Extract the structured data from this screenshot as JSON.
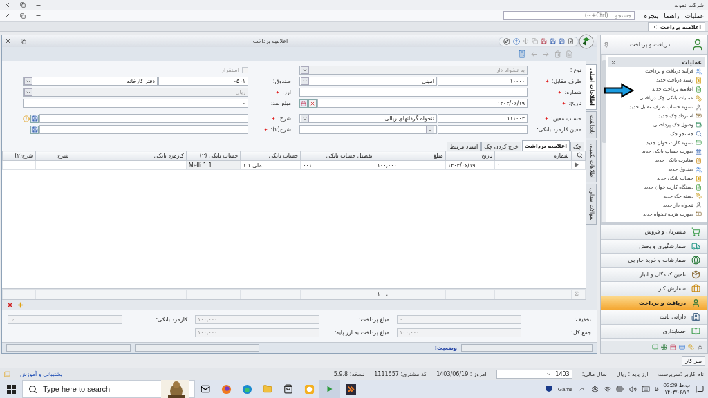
{
  "app_title": "شرکت نمونه",
  "menu": [
    {
      "label": "عملیات"
    },
    {
      "label": "راهنما"
    },
    {
      "label": "پنجره"
    }
  ],
  "search": {
    "placeholder": "جستجو... (Ctrl+~)"
  },
  "doc_tabs": [
    {
      "label": "اعلامیه پرداخت",
      "selected": true
    }
  ],
  "form_window": {
    "title": "اعلامیه پرداخت",
    "side_tabs": [
      {
        "label": "اطلاعات اصلی",
        "selected": true
      },
      {
        "label": "یادداشت",
        "selected": false
      },
      {
        "label": "اطلاعات تکمیلی",
        "selected": false
      },
      {
        "label": "سوالات متداول",
        "selected": false
      }
    ],
    "right_column": {
      "top": [
        {
          "label": "نوع :",
          "required": true,
          "kind": "combo",
          "value": "به تنخواه دار",
          "disabled": true
        },
        {
          "label": "طرف مقابل:",
          "required": true,
          "kind": "code_combo",
          "code": "۱۰۰۰۰",
          "value": "امینی"
        },
        {
          "label": "شماره:",
          "required": true,
          "kind": "text"
        },
        {
          "label": "تاریخ:",
          "required": true,
          "kind": "date",
          "value": "۱۴۰۳/۰۶/۱۹"
        }
      ],
      "bottom": [
        {
          "label": "حساب معین:",
          "required": true,
          "kind": "code_combo",
          "code": "۱۱۱۰۰۳",
          "value": "تنخواه گردانهای ریالی"
        },
        {
          "label": "معین کارمزد بانکی:",
          "required": false,
          "kind": "code_combo"
        }
      ]
    },
    "left_column": {
      "checkbox": {
        "label": "استقرار",
        "checked": false,
        "disabled": true
      },
      "top": [
        {
          "label": "صندوق:",
          "required": false,
          "kind": "code_combo",
          "code": "۰۵۰۱",
          "value": "دفتر کارخانه"
        },
        {
          "label": "ارز:",
          "required": true,
          "kind": "combo",
          "value": "ریال",
          "disabled": true
        },
        {
          "label": "مبلغ نقد:",
          "required": false,
          "kind": "text",
          "value": "۰"
        }
      ],
      "bottom": [
        {
          "label": "شرح:",
          "required": true,
          "kind": "memo",
          "warning": true
        },
        {
          "label": "شرح(۲):",
          "required": true,
          "kind": "memo",
          "warning": false
        }
      ]
    },
    "grid_tabs": [
      {
        "label": "چک",
        "selected": false
      },
      {
        "label": "اعلامیه برداشت",
        "selected": true
      },
      {
        "label": "خرج کردن چک",
        "selected": false
      },
      {
        "label": "اسناد مرتبط",
        "selected": false
      }
    ],
    "columns": [
      "شماره",
      "تاریخ",
      "مبلغ",
      "تفصیل حساب بانکی",
      "حساب بانکی",
      "حساب بانکی (۲)",
      "کارمزد بانکی",
      "شرح",
      "شرح(۲)"
    ],
    "rows": [
      {
        "cells": [
          "۱",
          "۱۴۰۳/۰۶/۱۹",
          "۱۰۰,۰۰۰",
          "۰۰۱",
          "ملی ۱ ۱",
          "Melli 1 1"
        ]
      }
    ],
    "totals": {
      "amount": "۱۰۰,۰۰۰",
      "bank_fee": "۰"
    },
    "summary": [
      {
        "label": "تخفیف:",
        "value": "۰",
        "disabled": true
      },
      {
        "label": "جمع کل:",
        "value": "۱۰۰,۰۰۰",
        "disabled": true
      },
      {
        "label": "مبلغ پرداخت:",
        "value": "۱۰۰,۰۰۰",
        "disabled": true
      },
      {
        "label": "مبلغ پرداخت به ارز پایه:",
        "value": "۱۰۰,۰۰۰",
        "disabled": true
      },
      {
        "label": "کارمزد بانکی:",
        "disabled": true
      }
    ],
    "status_label": "وضعیت:"
  },
  "sidebar": {
    "title": "دریافت و پرداخت",
    "section": "عملیات",
    "items": [
      "فرآیند دریافت و پرداخت",
      "رسید دریافت جدید",
      "اعلامیه پرداخت جدید",
      "عملیات بانکی چک دریافتنی",
      "تسویه حساب طرف مقابل جدید",
      "استرداد چک جدید",
      "وصول چک پرداختنی",
      "جستجو چک",
      "تسویه کارت خوان جدید",
      "صورت حساب بانکی جدید",
      "مغایرت بانکی جدید",
      "صندوق جدید",
      "حساب بانکی جدید",
      "دستگاه کارت خوان جدید",
      "دسته چک جدید",
      "تنخواه دار جدید",
      "صورت هزینه تنخواه جدید"
    ],
    "modules": [
      {
        "label": "مشتریان و فروش",
        "selected": false
      },
      {
        "label": "سفارشگیری و پخش",
        "selected": false
      },
      {
        "label": "سفارشات و خرید خارجی",
        "selected": false
      },
      {
        "label": "تامین کنندگان و انبار",
        "selected": false
      },
      {
        "label": "سفارش کار",
        "selected": false
      },
      {
        "label": "دریافت و پرداخت",
        "selected": true
      },
      {
        "label": "دارایی ثابت",
        "selected": false
      },
      {
        "label": "حسابداری",
        "selected": false
      }
    ]
  },
  "desk_button": "میز کار",
  "status_bar": {
    "user": "نام کاربر :سرپرست",
    "currency": "ارز پایه : ریال",
    "year_label": "سال مالی:",
    "year": "1403",
    "today": "امروز : 1403/06/19",
    "customer": "کد مشتری: 1111657",
    "version": "نسخه: 5.9.8",
    "support": "پشتیبانی و آموزش"
  },
  "taskbar": {
    "search_placeholder": "Type here to search",
    "game": "Game",
    "lang": "فا",
    "time": "02:29 ب.ظ",
    "date": "۱۴۰۳/۰۶/۱۹"
  }
}
